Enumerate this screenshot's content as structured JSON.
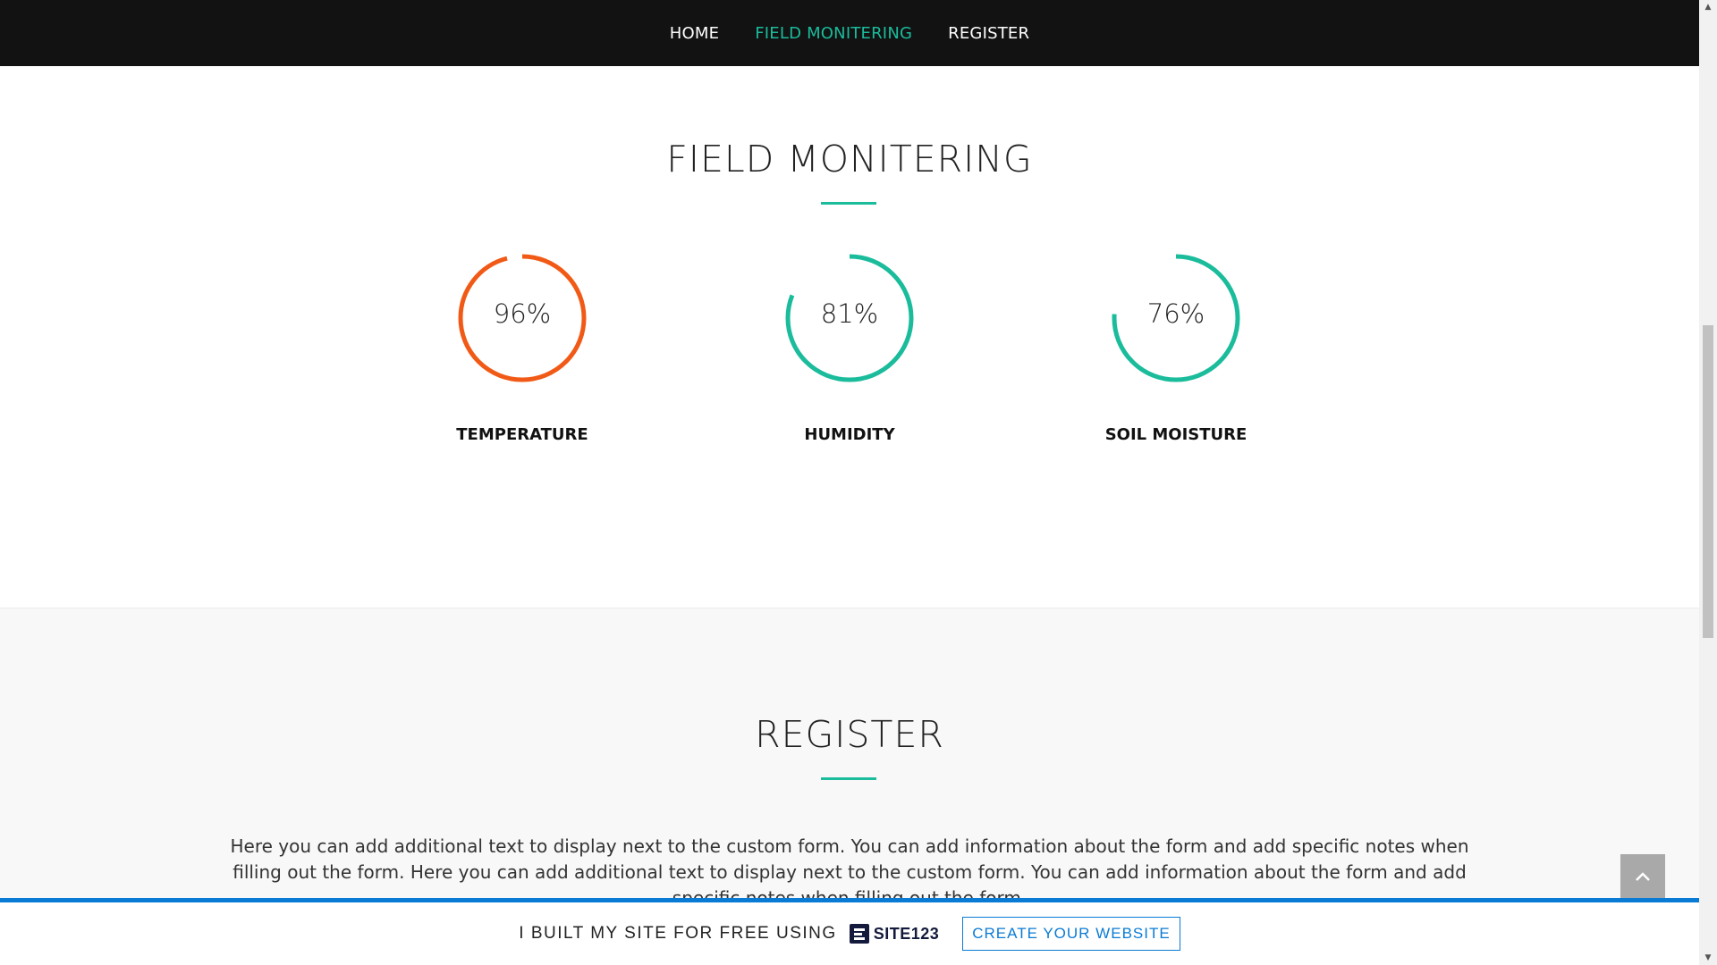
{
  "nav": {
    "items": [
      {
        "label": "HOME",
        "active": false
      },
      {
        "label": "FIELD MONITERING",
        "active": true
      },
      {
        "label": "REGISTER",
        "active": false
      }
    ]
  },
  "monitor": {
    "title": "FIELD MONITERING",
    "gauges": [
      {
        "label": "TEMPERATURE",
        "value_text": "96%",
        "percent": 96,
        "color": "#f15a16"
      },
      {
        "label": "HUMIDITY",
        "value_text": "81%",
        "percent": 81,
        "color": "#1abc9c"
      },
      {
        "label": "SOIL MOISTURE",
        "value_text": "76%",
        "percent": 76,
        "color": "#1abc9c"
      }
    ]
  },
  "register": {
    "title": "REGISTER",
    "text": "Here you can add additional text to display next to the custom form. You can add information about the form and add specific notes when filling out the form. Here you can add additional text to display next to the custom form. You can add information about the form and add specific notes when filling out the form."
  },
  "banner": {
    "built_text": "I BUILT MY SITE FOR FREE USING",
    "logo_text": "SITE123",
    "cta_label": "CREATE YOUR WEBSITE"
  },
  "colors": {
    "accent": "#1abc9c",
    "banner_blue": "#0a7bd4",
    "nav_bg": "#121212"
  }
}
